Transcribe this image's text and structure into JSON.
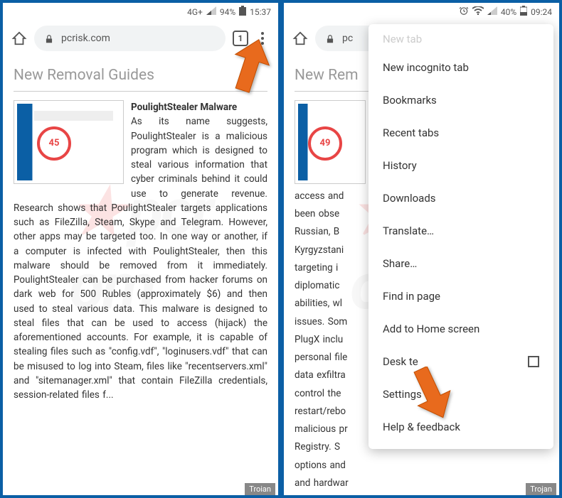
{
  "left": {
    "status": {
      "net": "4G+",
      "battery_pct": "94%",
      "time": "15:37"
    },
    "toolbar": {
      "url": "pcrisk.com",
      "tab_count": "1"
    },
    "page_title": "New Removal Guides",
    "article_title": "PoulightStealer Malware",
    "gauge": "45",
    "body": "As its name suggests, PoulightStealer is a malicious program which is designed to steal various information that cyber criminals behind it could use to generate revenue. Research shows that PoulightStealer targets applications such as FileZilla, Steam, Skype and Telegram. However, other apps may be targeted too. In one way or another, if a computer is infected with PoulightStealer, then this malware should be removed from it immediately. PoulightStealer can be purchased from hacker forums on dark web for 500 Rubles (approximately $6) and then used to steal various data. This malware is designed to steal files that can be used to access (hijack) the aforementioned accounts. For example, it is capable of stealing files such as \"config.vdf\", \"loginusers.vdf\" that can be misused to log into Steam, files like \"recentservers.xml\" and \"sitemanager.xml\" that contain FileZilla credentials, session-related files f...",
    "tag": "Troian"
  },
  "right": {
    "status": {
      "battery_pct": "40%",
      "time": "09:24"
    },
    "toolbar": {
      "url": "pc"
    },
    "page_title": "New Rem",
    "gauge": "49",
    "body_lines": [
      "access and",
      "been obse",
      "Russian, B",
      "Kyrgyzstani",
      "targeting i",
      "diplomatic",
      "abilities, wl",
      "issues. Som",
      "PlugX inclu",
      "personal file",
      "data exfiltra",
      "control the",
      "restart/rebo",
      "malicious pr",
      "Registry. S",
      "options and",
      "and hardwar"
    ],
    "tag": "Trojan",
    "menu": {
      "cut": "New tab",
      "items": [
        "New incognito tab",
        "Bookmarks",
        "Recent tabs",
        "History",
        "Downloads",
        "Translate…",
        "Share…",
        "Find in page",
        "Add to Home screen"
      ],
      "desktop": "Desk           te",
      "after": [
        "Settings",
        "Help & feedback"
      ]
    }
  },
  "watermark": "pcr        om"
}
